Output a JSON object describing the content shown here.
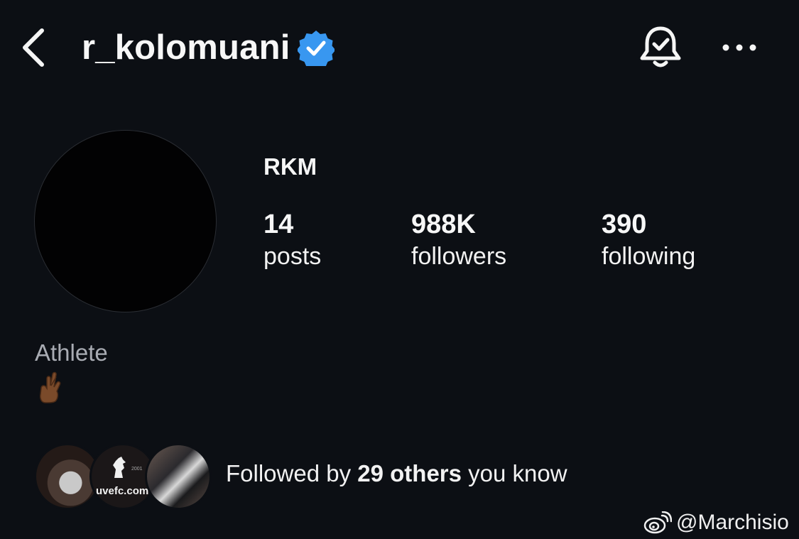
{
  "header": {
    "username": "r_kolomuani",
    "verified": true,
    "accent_color": "#3897f0",
    "back_icon": "chevron-left-icon",
    "bell_icon": "bell-check-icon",
    "more_icon": "more-horizontal-icon"
  },
  "profile": {
    "display_name": "RKM",
    "stats": {
      "posts": {
        "count": "14",
        "label": "posts"
      },
      "followers": {
        "count": "988K",
        "label": "followers"
      },
      "following": {
        "count": "390",
        "label": "following"
      }
    },
    "category": "Athlete",
    "bio": "🤞🏾"
  },
  "followed_by": {
    "prefix": "Followed by ",
    "count_text": "29 others",
    "suffix": " you know",
    "avatar_2_text": "uvefc.com",
    "avatar_2_year": "2001"
  },
  "watermark": {
    "text": "@Marchisio",
    "icon": "weibo-icon"
  }
}
